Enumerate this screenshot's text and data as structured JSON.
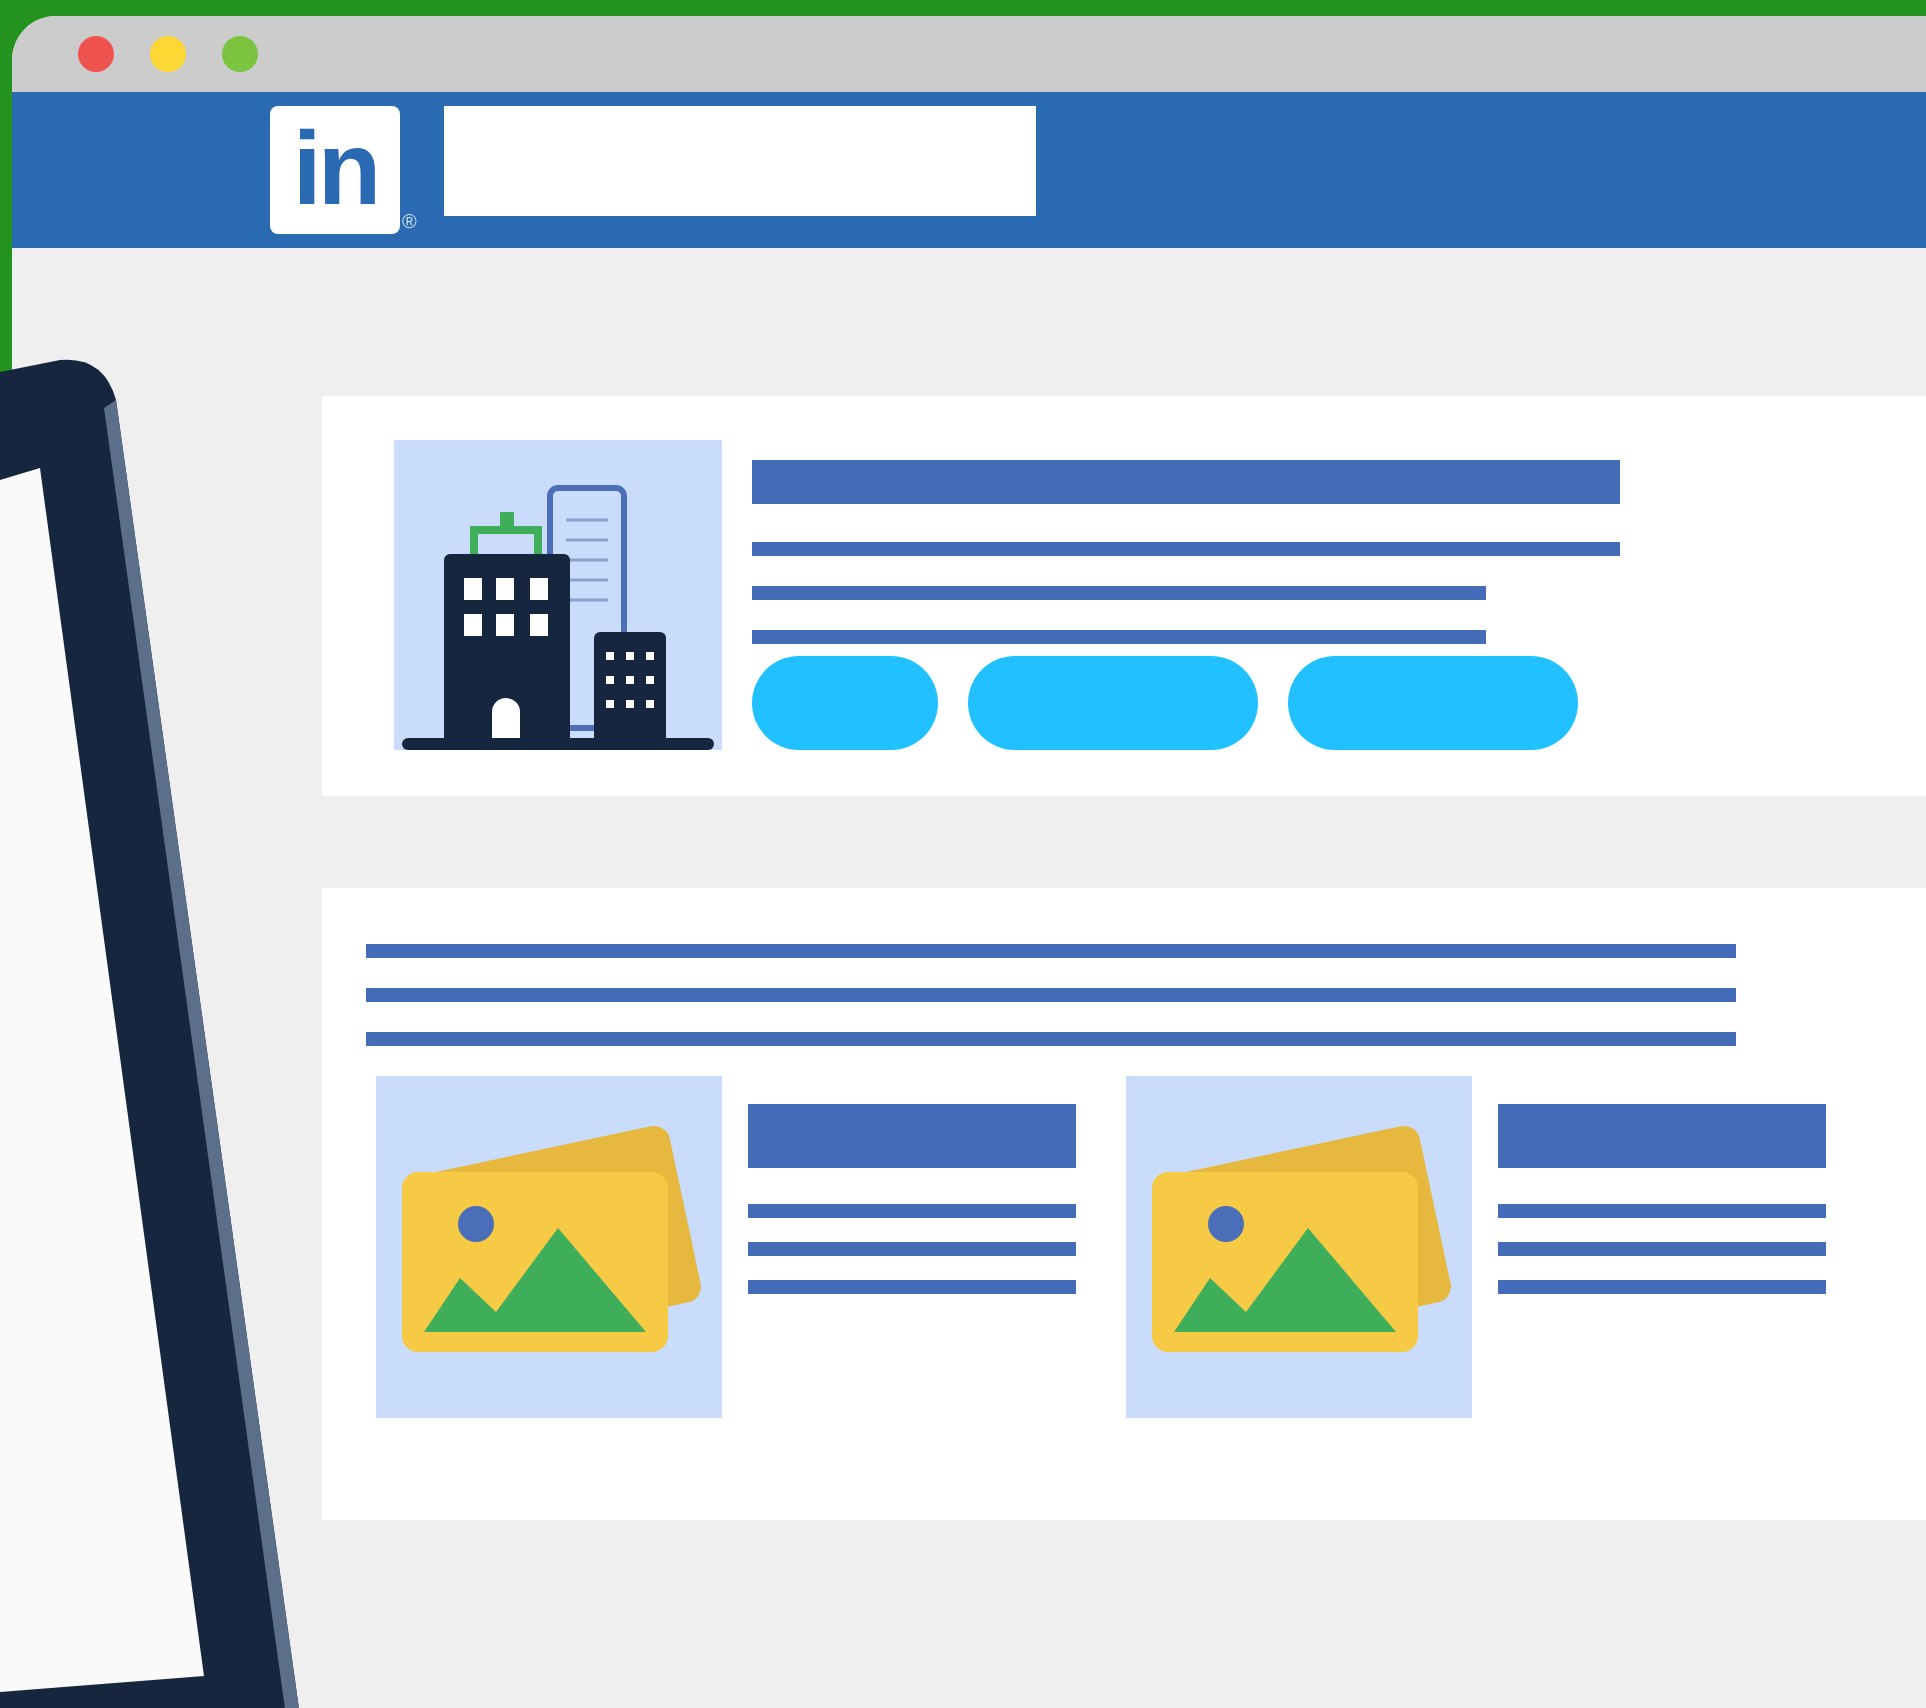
{
  "window": {
    "controls": [
      {
        "color": "#ef5350"
      },
      {
        "color": "#fdd835"
      },
      {
        "color": "#7cc33f"
      }
    ]
  },
  "header": {
    "logo": "in",
    "trademark": "®"
  }
}
